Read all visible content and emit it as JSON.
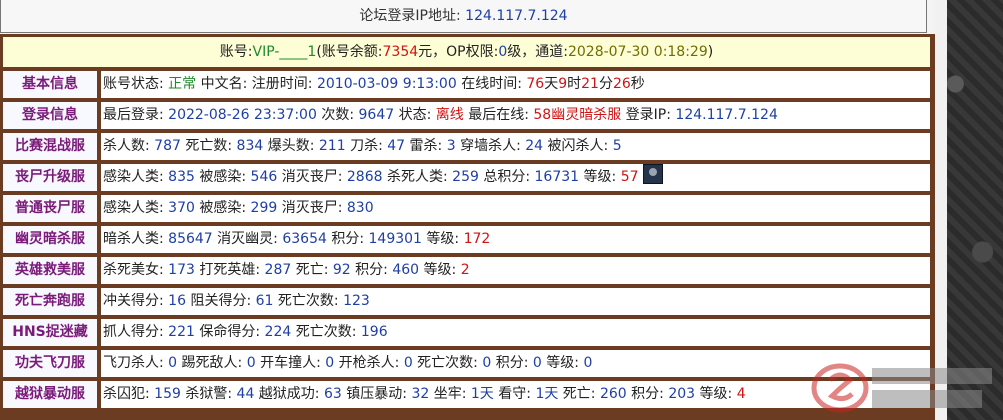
{
  "top": {
    "label": "论坛登录IP地址:",
    "ip": "124.117.7.124"
  },
  "header": {
    "p1": "账号:",
    "account": "VIP-____1",
    "p2": "(账号余额:",
    "balance": "7354",
    "p3": "元，OP权限:",
    "op": "0",
    "p4": "级，通道:",
    "date": "2028-07-30 0:18:29",
    "p5": ")"
  },
  "rows": [
    {
      "cat": "基本信息",
      "parts": [
        [
          "账号状态: ",
          ""
        ],
        [
          "正常",
          "green"
        ],
        [
          " 中文名: 注册时间: ",
          ""
        ],
        [
          "2010-03-09 9:13:00",
          "blue"
        ],
        [
          " 在线时间: ",
          ""
        ],
        [
          "76",
          "red"
        ],
        [
          "天",
          ""
        ],
        [
          "9",
          "red"
        ],
        [
          "时",
          ""
        ],
        [
          "21",
          "red"
        ],
        [
          "分",
          ""
        ],
        [
          "26",
          "red"
        ],
        [
          "秒",
          ""
        ]
      ]
    },
    {
      "cat": "登录信息",
      "parts": [
        [
          "最后登录: ",
          ""
        ],
        [
          "2022-08-26 23:37:00",
          "blue"
        ],
        [
          " 次数: ",
          ""
        ],
        [
          "9647",
          "blue"
        ],
        [
          " 状态: ",
          ""
        ],
        [
          "离线",
          "red"
        ],
        [
          " 最后在线: ",
          ""
        ],
        [
          "58幽灵暗杀服",
          "red"
        ],
        [
          " 登录IP: ",
          ""
        ],
        [
          "124.117.7.124",
          "blue"
        ]
      ]
    },
    {
      "cat": "比赛混战服",
      "parts": [
        [
          "杀人数: ",
          ""
        ],
        [
          "787",
          "blue"
        ],
        [
          " 死亡数: ",
          ""
        ],
        [
          "834",
          "blue"
        ],
        [
          " 爆头数: ",
          ""
        ],
        [
          "211",
          "blue"
        ],
        [
          " 刀杀: ",
          ""
        ],
        [
          "47",
          "blue"
        ],
        [
          " 雷杀: ",
          ""
        ],
        [
          "3",
          "blue"
        ],
        [
          " 穿墙杀人: ",
          ""
        ],
        [
          "24",
          "blue"
        ],
        [
          " 被闪杀人: ",
          ""
        ],
        [
          "5",
          "blue"
        ]
      ]
    },
    {
      "cat": "丧尸升级服",
      "parts": [
        [
          "感染人类: ",
          ""
        ],
        [
          "835",
          "blue"
        ],
        [
          " 被感染: ",
          ""
        ],
        [
          "546",
          "blue"
        ],
        [
          " 消灭丧尸: ",
          ""
        ],
        [
          "2868",
          "blue"
        ],
        [
          " 杀死人类: ",
          ""
        ],
        [
          "259",
          "blue"
        ],
        [
          " 总积分: ",
          ""
        ],
        [
          "16731",
          "blue"
        ],
        [
          " 等级: ",
          ""
        ],
        [
          "57",
          "red"
        ]
      ],
      "avatar": true
    },
    {
      "cat": "普通丧尸服",
      "parts": [
        [
          "感染人类: ",
          ""
        ],
        [
          "370",
          "blue"
        ],
        [
          " 被感染: ",
          ""
        ],
        [
          "299",
          "blue"
        ],
        [
          " 消灭丧尸: ",
          ""
        ],
        [
          "830",
          "blue"
        ]
      ]
    },
    {
      "cat": "幽灵暗杀服",
      "parts": [
        [
          "暗杀人类: ",
          ""
        ],
        [
          "85647",
          "blue"
        ],
        [
          " 消灭幽灵: ",
          ""
        ],
        [
          "63654",
          "blue"
        ],
        [
          " 积分: ",
          ""
        ],
        [
          "149301",
          "blue"
        ],
        [
          " 等级: ",
          ""
        ],
        [
          "172",
          "red"
        ]
      ]
    },
    {
      "cat": "英雄救美服",
      "parts": [
        [
          "杀死美女: ",
          ""
        ],
        [
          "173",
          "blue"
        ],
        [
          " 打死英雄: ",
          ""
        ],
        [
          "287",
          "blue"
        ],
        [
          " 死亡: ",
          ""
        ],
        [
          "92",
          "blue"
        ],
        [
          " 积分: ",
          ""
        ],
        [
          "460",
          "blue"
        ],
        [
          " 等级: ",
          ""
        ],
        [
          "2",
          "red"
        ]
      ]
    },
    {
      "cat": "死亡奔跑服",
      "parts": [
        [
          "冲关得分: ",
          ""
        ],
        [
          "16",
          "blue"
        ],
        [
          " 阻关得分: ",
          ""
        ],
        [
          "61",
          "blue"
        ],
        [
          " 死亡次数: ",
          ""
        ],
        [
          "123",
          "blue"
        ]
      ]
    },
    {
      "cat": "HNS捉迷藏",
      "parts": [
        [
          "抓人得分: ",
          ""
        ],
        [
          "221",
          "blue"
        ],
        [
          " 保命得分: ",
          ""
        ],
        [
          "224",
          "blue"
        ],
        [
          " 死亡次数: ",
          ""
        ],
        [
          "196",
          "blue"
        ]
      ]
    },
    {
      "cat": "功夫飞刀服",
      "parts": [
        [
          "飞刀杀人: ",
          ""
        ],
        [
          "0",
          "blue"
        ],
        [
          " 踢死敌人: ",
          ""
        ],
        [
          "0",
          "blue"
        ],
        [
          " 开车撞人: ",
          ""
        ],
        [
          "0",
          "blue"
        ],
        [
          " 开枪杀人: ",
          ""
        ],
        [
          "0",
          "blue"
        ],
        [
          " 死亡次数: ",
          ""
        ],
        [
          "0",
          "blue"
        ],
        [
          " 积分: ",
          ""
        ],
        [
          "0",
          "blue"
        ],
        [
          " 等级: ",
          ""
        ],
        [
          "0",
          "blue"
        ]
      ]
    },
    {
      "cat": "越狱暴动服",
      "parts": [
        [
          "杀囚犯: ",
          ""
        ],
        [
          "159",
          "blue"
        ],
        [
          " 杀狱警: ",
          ""
        ],
        [
          "44",
          "blue"
        ],
        [
          " 越狱成功: ",
          ""
        ],
        [
          "63",
          "blue"
        ],
        [
          " 镇压暴动: ",
          ""
        ],
        [
          "32",
          "blue"
        ],
        [
          " 坐牢: ",
          ""
        ],
        [
          "1天",
          "blue"
        ],
        [
          " 看守: ",
          ""
        ],
        [
          "1天",
          "blue"
        ],
        [
          " 死亡: ",
          ""
        ],
        [
          "260",
          "blue"
        ],
        [
          " 积分: ",
          ""
        ],
        [
          "203",
          "blue"
        ],
        [
          " 等级: ",
          ""
        ],
        [
          "4",
          "red"
        ]
      ]
    }
  ],
  "colors": {
    "frame": "#6b3c22",
    "category": "#7a1b7a",
    "value_blue": "#1e3fa6",
    "value_red": "#d01414",
    "ok_green": "#1e8a2a"
  }
}
